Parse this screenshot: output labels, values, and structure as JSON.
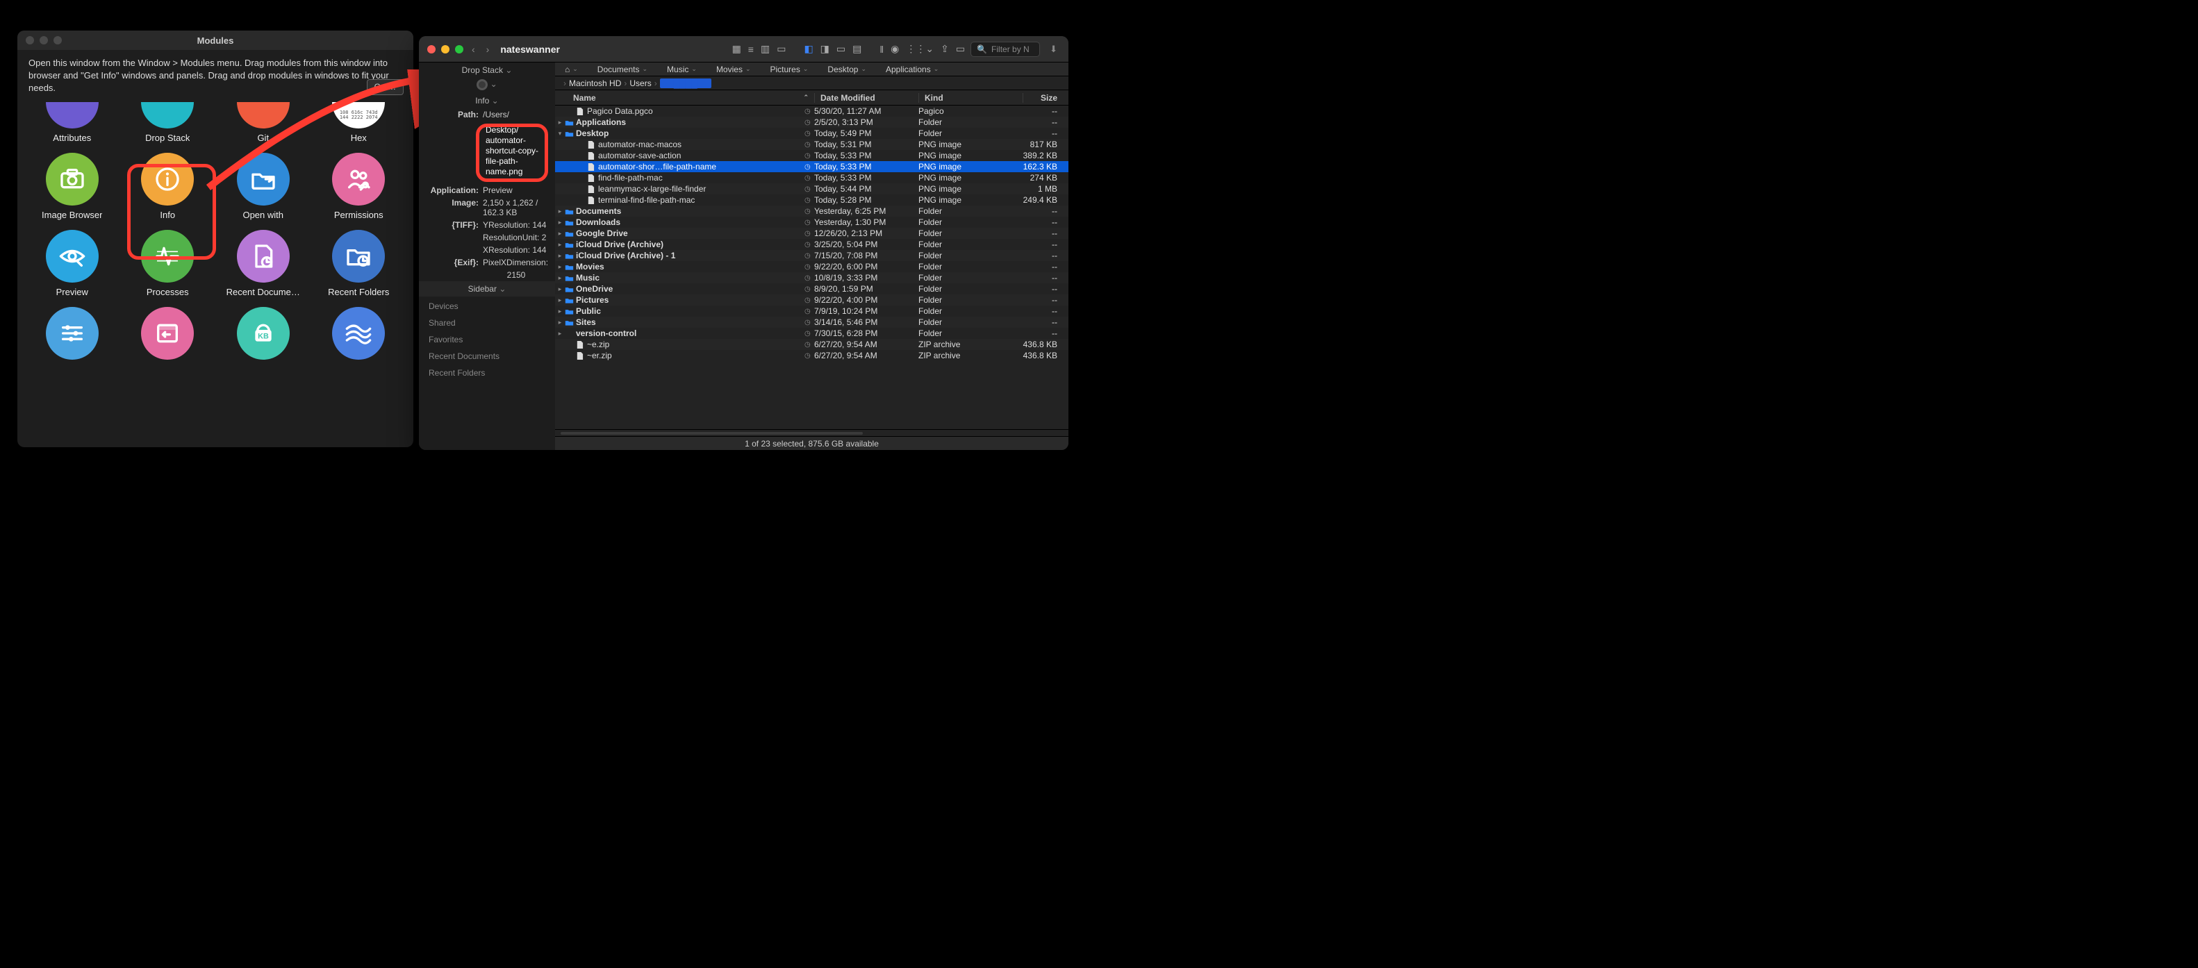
{
  "modules": {
    "title": "Modules",
    "help_text": "Open this window from the Window > Modules menu. Drag modules from this window into browser and \"Get Info\" windows and panels. Drag and drop modules in windows to fit your needs.",
    "button_partial": "Get…",
    "items": [
      {
        "label": "Attributes",
        "color": "#6d5bd0",
        "shape": "half"
      },
      {
        "label": "Drop Stack",
        "color": "#22b8c6",
        "shape": "half"
      },
      {
        "label": "Git",
        "color": "#ef5b3e",
        "shape": "half"
      },
      {
        "label": "Hex",
        "color": "#ffffff",
        "shape": "hex"
      },
      {
        "label": "Image Browser",
        "color": "#7fbf3f",
        "shape": "full",
        "glyph": "camera"
      },
      {
        "label": "Info",
        "color": "#f2a63b",
        "shape": "full",
        "glyph": "info"
      },
      {
        "label": "Open with",
        "color": "#2f8ad8",
        "shape": "full",
        "glyph": "folder"
      },
      {
        "label": "Permissions",
        "color": "#e46aa0",
        "shape": "full",
        "glyph": "people"
      },
      {
        "label": "Preview",
        "color": "#2aa6e0",
        "shape": "full",
        "glyph": "eye"
      },
      {
        "label": "Processes",
        "color": "#52b24a",
        "shape": "full",
        "glyph": "wave"
      },
      {
        "label": "Recent Docume…",
        "color": "#b678d6",
        "shape": "full",
        "glyph": "docclock"
      },
      {
        "label": "Recent Folders",
        "color": "#3c74c8",
        "shape": "full",
        "glyph": "folderclock"
      },
      {
        "label": "",
        "color": "#4aa3e0",
        "shape": "full",
        "glyph": "sliders"
      },
      {
        "label": "",
        "color": "#e46aa0",
        "shape": "full",
        "glyph": "back"
      },
      {
        "label": "",
        "color": "#41c7b0",
        "shape": "full",
        "glyph": "kb"
      },
      {
        "label": "",
        "color": "#4a7fe0",
        "shape": "full",
        "glyph": "waves"
      }
    ],
    "hex_sample": "108 616c 743d\n144 2222 2074"
  },
  "finder": {
    "window_title": "nateswanner",
    "search_placeholder": "Filter by N",
    "nav_tabs": [
      {
        "icon": "home"
      },
      {
        "label": "Documents"
      },
      {
        "label": "Music"
      },
      {
        "label": "Movies"
      },
      {
        "label": "Pictures"
      },
      {
        "label": "Desktop"
      },
      {
        "label": "Applications"
      }
    ],
    "crumbs": [
      "",
      "Macintosh HD",
      "Users",
      "█████"
    ],
    "columns": {
      "name": "Name",
      "date": "Date Modified",
      "kind": "Kind",
      "size": "Size"
    },
    "rows": [
      {
        "indent": 1,
        "icon": "doc",
        "name": "Pagico Data.pgco",
        "date": "5/30/20, 11:27 AM",
        "kind": "Pagico",
        "size": "--"
      },
      {
        "indent": 0,
        "disclosure": ">",
        "icon": "folder",
        "bold": true,
        "name": "Applications",
        "date": "2/5/20, 3:13 PM",
        "kind": "Folder",
        "size": "--"
      },
      {
        "indent": 0,
        "disclosure": "v",
        "icon": "folder",
        "bold": true,
        "name": "Desktop",
        "date": "Today, 5:49 PM",
        "kind": "Folder",
        "size": "--"
      },
      {
        "indent": 2,
        "icon": "doc",
        "name": "automator-mac-macos",
        "date": "Today, 5:31 PM",
        "kind": "PNG image",
        "size": "817 KB"
      },
      {
        "indent": 2,
        "icon": "doc",
        "name": "automator-save-action",
        "date": "Today, 5:33 PM",
        "kind": "PNG image",
        "size": "389.2 KB"
      },
      {
        "indent": 2,
        "icon": "doc",
        "name": "automator-shor…file-path-name",
        "date": "Today, 5:33 PM",
        "kind": "PNG image",
        "size": "162.3 KB",
        "selected": true
      },
      {
        "indent": 2,
        "icon": "doc",
        "name": "find-file-path-mac",
        "date": "Today, 5:33 PM",
        "kind": "PNG image",
        "size": "274 KB"
      },
      {
        "indent": 2,
        "icon": "doc",
        "name": "leanmymac-x-large-file-finder",
        "date": "Today, 5:44 PM",
        "kind": "PNG image",
        "size": "1 MB"
      },
      {
        "indent": 2,
        "icon": "doc",
        "name": "terminal-find-file-path-mac",
        "date": "Today, 5:28 PM",
        "kind": "PNG image",
        "size": "249.4 KB"
      },
      {
        "indent": 0,
        "disclosure": ">",
        "icon": "folder",
        "bold": true,
        "name": "Documents",
        "date": "Yesterday, 6:25 PM",
        "kind": "Folder",
        "size": "--"
      },
      {
        "indent": 0,
        "disclosure": ">",
        "icon": "folder",
        "bold": true,
        "name": "Downloads",
        "date": "Yesterday, 1:30 PM",
        "kind": "Folder",
        "size": "--"
      },
      {
        "indent": 0,
        "disclosure": ">",
        "icon": "folder",
        "bold": true,
        "name": "Google Drive",
        "date": "12/26/20, 2:13 PM",
        "kind": "Folder",
        "size": "--"
      },
      {
        "indent": 0,
        "disclosure": ">",
        "icon": "folder",
        "bold": true,
        "name": "iCloud Drive (Archive)",
        "date": "3/25/20, 5:04 PM",
        "kind": "Folder",
        "size": "--"
      },
      {
        "indent": 0,
        "disclosure": ">",
        "icon": "folder",
        "bold": true,
        "name": "iCloud Drive (Archive) - 1",
        "date": "7/15/20, 7:08 PM",
        "kind": "Folder",
        "size": "--"
      },
      {
        "indent": 0,
        "disclosure": ">",
        "icon": "folder",
        "bold": true,
        "name": "Movies",
        "date": "9/22/20, 6:00 PM",
        "kind": "Folder",
        "size": "--"
      },
      {
        "indent": 0,
        "disclosure": ">",
        "icon": "folder",
        "bold": true,
        "name": "Music",
        "date": "10/8/19, 3:33 PM",
        "kind": "Folder",
        "size": "--"
      },
      {
        "indent": 0,
        "disclosure": ">",
        "icon": "folder",
        "bold": true,
        "name": "OneDrive",
        "date": "8/9/20, 1:59 PM",
        "kind": "Folder",
        "size": "--"
      },
      {
        "indent": 0,
        "disclosure": ">",
        "icon": "folder",
        "bold": true,
        "name": "Pictures",
        "date": "9/22/20, 4:00 PM",
        "kind": "Folder",
        "size": "--"
      },
      {
        "indent": 0,
        "disclosure": ">",
        "icon": "folder",
        "bold": true,
        "name": "Public",
        "date": "7/9/19, 10:24 PM",
        "kind": "Folder",
        "size": "--"
      },
      {
        "indent": 0,
        "disclosure": ">",
        "icon": "folder",
        "bold": true,
        "name": "Sites",
        "date": "3/14/16, 5:46 PM",
        "kind": "Folder",
        "size": "--"
      },
      {
        "indent": 0,
        "disclosure": ">",
        "icon": "none",
        "bold": true,
        "name": "version-control",
        "date": "7/30/15, 6:28 PM",
        "kind": "Folder",
        "size": "--"
      },
      {
        "indent": 1,
        "icon": "doc",
        "name": "~e.zip",
        "date": "6/27/20, 9:54 AM",
        "kind": "ZIP archive",
        "size": "436.8 KB"
      },
      {
        "indent": 1,
        "icon": "doc",
        "name": "~er.zip",
        "date": "6/27/20, 9:54 AM",
        "kind": "ZIP archive",
        "size": "436.8 KB"
      }
    ],
    "status_text": "1 of 23 selected, 875.6 GB available",
    "info_panel": {
      "drop_stack_label": "Drop Stack",
      "info_label": "Info",
      "path_label": "Path:",
      "path_value": "/Users/",
      "path_box": "Desktop/\nautomator-\nshortcut-copy-\nfile-path-\nname.png",
      "application_label": "Application:",
      "application_value": "Preview",
      "image_label": "Image:",
      "image_value": "2,150 x 1,262 / 162.3 KB",
      "tiff_label": "{TIFF}:",
      "tiff_yres": "YResolution: 144",
      "tiff_unit": "ResolutionUnit: 2",
      "tiff_xres": "XResolution: 144",
      "exif_label": "{Exif}:",
      "exif_px": "PixelXDimension:",
      "exif_px_val": "2150",
      "sidebar_label": "Sidebar",
      "sidebar_items": [
        "Devices",
        "Shared",
        "Favorites",
        "Recent Documents",
        "Recent Folders"
      ]
    }
  }
}
